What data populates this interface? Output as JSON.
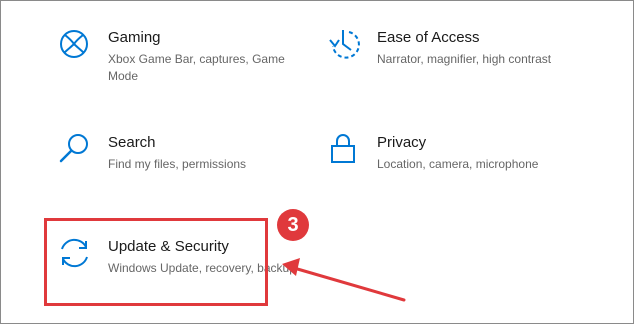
{
  "tiles": {
    "gaming": {
      "title": "Gaming",
      "desc": "Xbox Game Bar, captures, Game Mode",
      "icon": "xbox-icon"
    },
    "ease": {
      "title": "Ease of Access",
      "desc": "Narrator, magnifier, high contrast",
      "icon": "ease-of-access-icon"
    },
    "search": {
      "title": "Search",
      "desc": "Find my files, permissions",
      "icon": "search-icon"
    },
    "privacy": {
      "title": "Privacy",
      "desc": "Location, camera, microphone",
      "icon": "lock-icon"
    },
    "update": {
      "title": "Update & Security",
      "desc": "Windows Update, recovery, backup",
      "icon": "sync-icon"
    }
  },
  "annotation": {
    "step": "3",
    "color": "#e0393c"
  },
  "colors": {
    "accent": "#0078d4",
    "title": "#1a1a1a",
    "desc": "#666666"
  }
}
